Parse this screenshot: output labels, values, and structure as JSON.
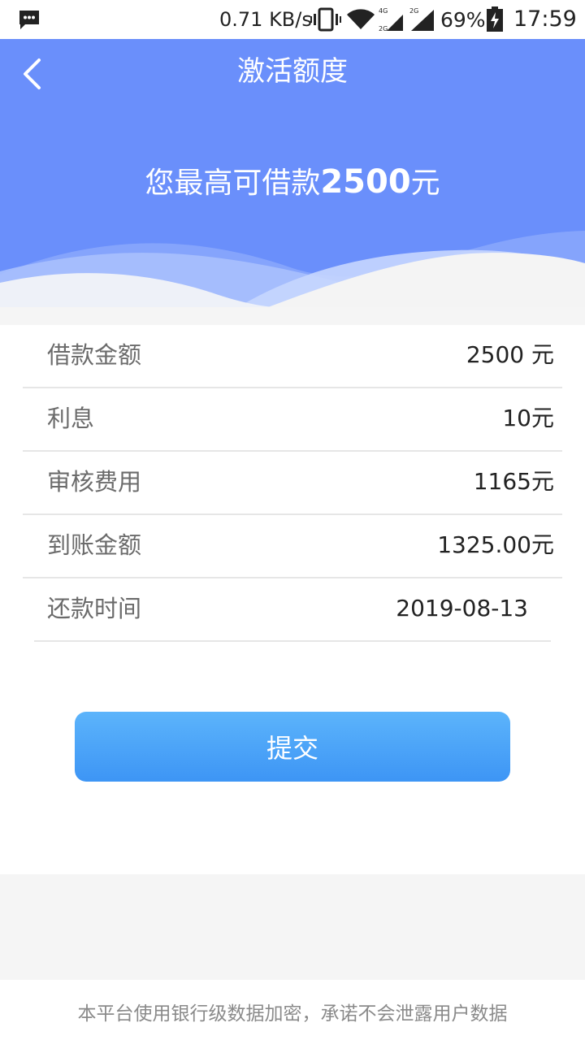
{
  "status_bar": {
    "speed": "0.71 KB/s",
    "battery": "69%",
    "time": "17:59",
    "icons": [
      "message-icon",
      "vibrate-icon",
      "wifi-icon",
      "signal-4g-icon",
      "signal-2g-icon",
      "battery-charging-icon"
    ]
  },
  "header": {
    "title": "激活额度",
    "hero_prefix": "您最高可借款",
    "hero_amount": "2500",
    "hero_suffix": "元",
    "color": "#6a8ffb"
  },
  "details": [
    {
      "label": "借款金额",
      "value": "2500 元"
    },
    {
      "label": "利息",
      "value": "10元"
    },
    {
      "label": "审核费用",
      "value": "1165元"
    },
    {
      "label": "到账金额",
      "value": "1325.00元"
    },
    {
      "label": "还款时间",
      "value": "2019-08-13"
    }
  ],
  "submit_label": "提交",
  "footer_note": "本平台使用银行级数据加密，承诺不会泄露用户数据",
  "colors": {
    "accent": "#3d95f5",
    "header": "#6a8ffb"
  }
}
